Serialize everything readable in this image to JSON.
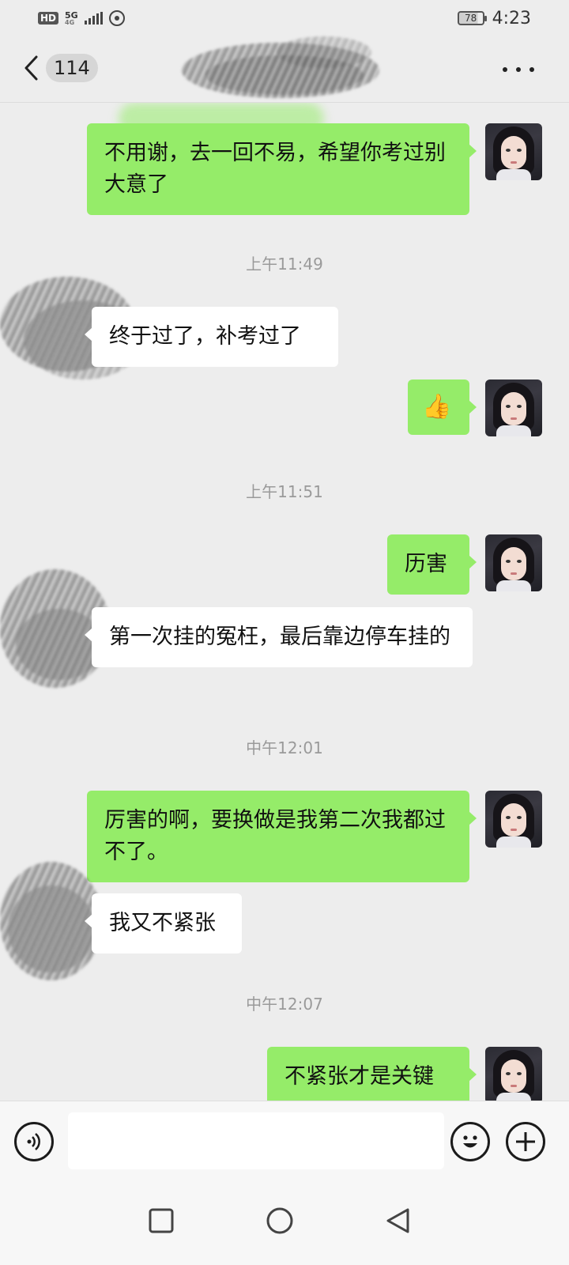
{
  "status_bar": {
    "hd": "HD",
    "network_top": "5G",
    "network_bottom": "4G",
    "battery": "78",
    "time": "4:23"
  },
  "header": {
    "unread_count": "114",
    "contact_name": ""
  },
  "messages": [
    {
      "type": "message",
      "side": "mine",
      "text": "不用谢，去一回不易，希望你考过别大意了"
    },
    {
      "type": "timestamp",
      "text": "上午11:49"
    },
    {
      "type": "message",
      "side": "theirs",
      "text": "终于过了，补考过了"
    },
    {
      "type": "message",
      "side": "mine",
      "text": "👍"
    },
    {
      "type": "timestamp",
      "text": "上午11:51"
    },
    {
      "type": "message",
      "side": "mine",
      "text": "历害"
    },
    {
      "type": "message",
      "side": "theirs",
      "text": "第一次挂的冤枉，最后靠边停车挂的"
    },
    {
      "type": "timestamp",
      "text": "中午12:01"
    },
    {
      "type": "message",
      "side": "mine",
      "text": " 厉害的啊，要换做是我第二次我都过不了。"
    },
    {
      "type": "message",
      "side": "theirs",
      "text": "我又不紧张"
    },
    {
      "type": "timestamp",
      "text": "中午12:07"
    },
    {
      "type": "message",
      "side": "mine",
      "text": "不紧张才是关键"
    }
  ],
  "input": {
    "value": "",
    "placeholder": ""
  },
  "icons": {
    "back": "chevron-left-icon",
    "more": "more-horizontal-icon",
    "voice": "voice-icon",
    "emoji": "emoji-icon",
    "plus": "plus-icon",
    "nav_recents": "square-icon",
    "nav_home": "circle-icon",
    "nav_back": "triangle-back-icon"
  },
  "colors": {
    "background": "#ededed",
    "my_bubble": "#95ec69",
    "their_bubble": "#ffffff",
    "timestamp": "#9a9a9a"
  }
}
